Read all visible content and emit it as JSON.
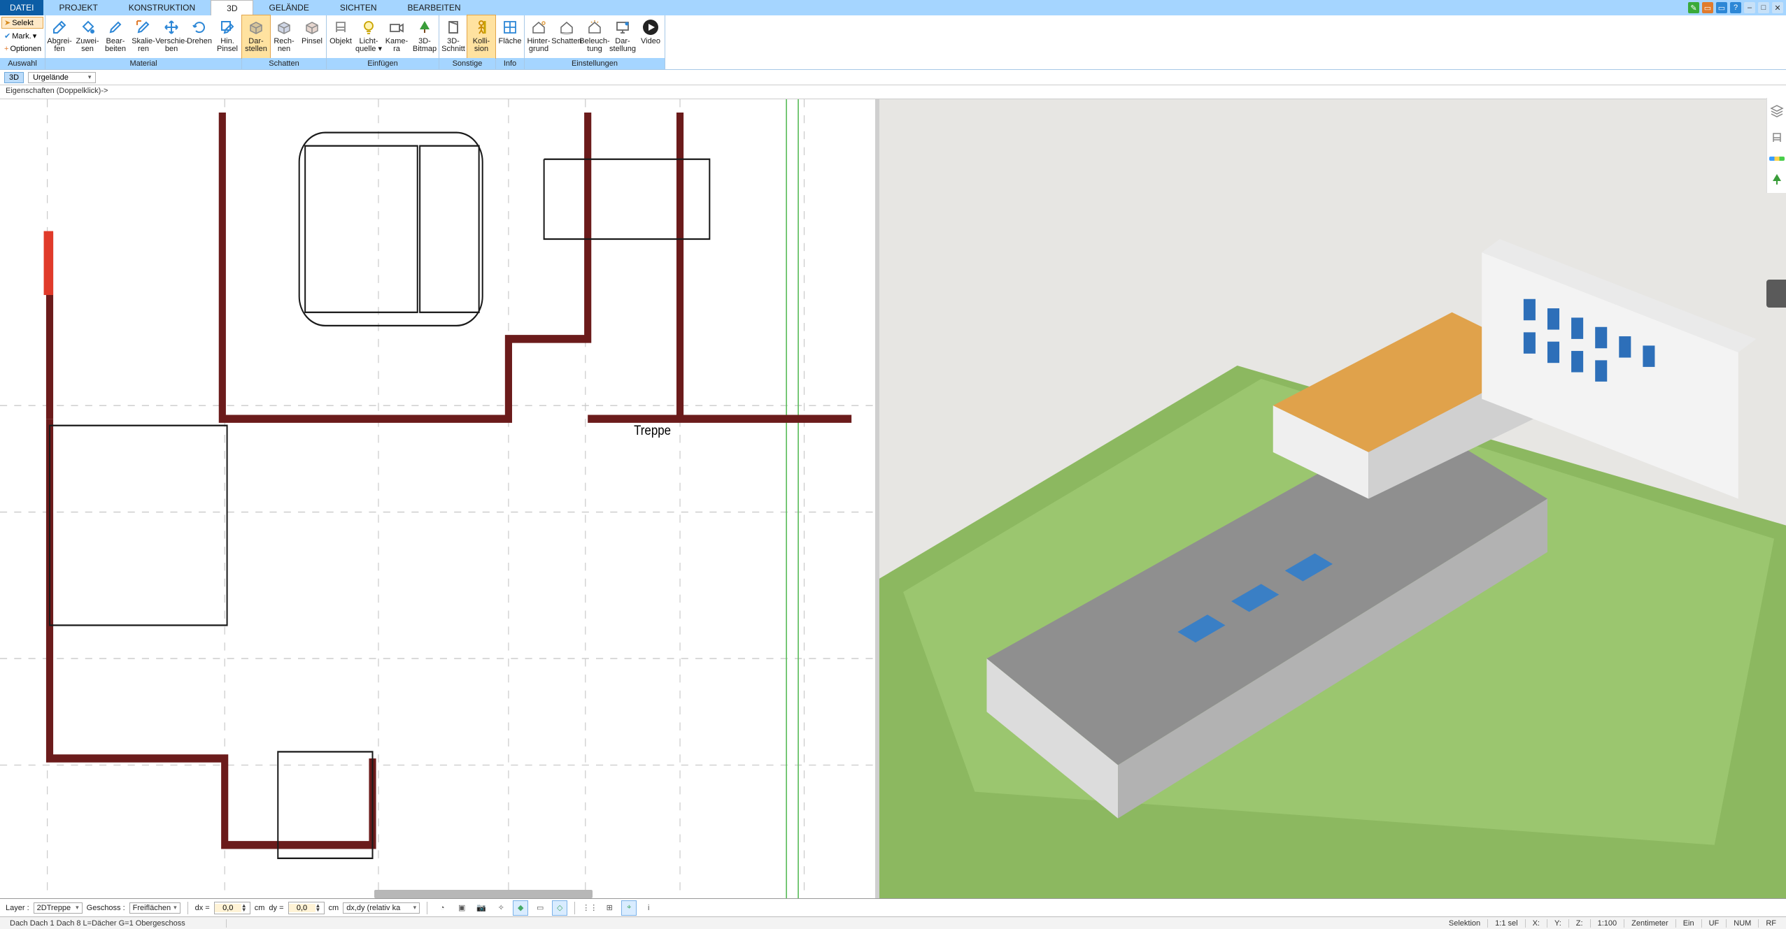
{
  "menu": {
    "file": "DATEI",
    "tabs": [
      "PROJEKT",
      "KONSTRUKTION",
      "3D",
      "GELÄNDE",
      "SICHTEN",
      "BEARBEITEN"
    ],
    "active_idx": 2
  },
  "title_icons": [
    "✎",
    "🗗",
    "🗗",
    "?",
    "_",
    "□",
    "✕"
  ],
  "ribbon": {
    "sel_panel": {
      "select": "Selekt",
      "mark": "Mark.",
      "options": "Optionen",
      "group_label": "Auswahl"
    },
    "material": {
      "group_label": "Material",
      "tools": [
        {
          "id": "abgreifen",
          "label": "Abgrei-\nfen",
          "glyph": "pipette"
        },
        {
          "id": "zuweisen",
          "label": "Zuwei-\nsen",
          "glyph": "bucket"
        },
        {
          "id": "bearbeiten",
          "label": "Bear-\nbeiten",
          "glyph": "brush-edit"
        },
        {
          "id": "skalieren",
          "label": "Skalie-\nren",
          "glyph": "brush-scale"
        },
        {
          "id": "verschieben",
          "label": "Verschie-\nben",
          "glyph": "move"
        },
        {
          "id": "drehen",
          "label": "Drehen",
          "glyph": "rotate"
        },
        {
          "id": "hinpinsel",
          "label": "Hin.\nPinsel",
          "glyph": "brush-back"
        }
      ]
    },
    "schatten": {
      "group_label": "Schatten",
      "tools": [
        {
          "id": "darstellen",
          "label": "Dar-\nstellen",
          "glyph": "box-sun",
          "active": true
        },
        {
          "id": "rechnen",
          "label": "Rech-\nnen",
          "glyph": "box-calc"
        },
        {
          "id": "pinsel",
          "label": "Pinsel",
          "glyph": "box-brush"
        }
      ]
    },
    "einfuegen": {
      "group_label": "Einfügen",
      "tools": [
        {
          "id": "objekt",
          "label": "Objekt",
          "glyph": "chair"
        },
        {
          "id": "lichtquelle",
          "label": "Licht-\nquelle ▾",
          "glyph": "bulb"
        },
        {
          "id": "kamera",
          "label": "Kame-\nra",
          "glyph": "camera"
        },
        {
          "id": "3dbitmap",
          "label": "3D-\nBitmap",
          "glyph": "tree"
        }
      ]
    },
    "sonstige": {
      "group_label": "Sonstige",
      "tools": [
        {
          "id": "3dschnitt",
          "label": "3D-\nSchnitt",
          "glyph": "door"
        },
        {
          "id": "kollision",
          "label": "Kolli-\nsion",
          "glyph": "person",
          "active": true
        }
      ]
    },
    "info": {
      "group_label": "Info",
      "tools": [
        {
          "id": "flaeche",
          "label": "Fläche",
          "glyph": "ruler-area"
        }
      ]
    },
    "einstellungen": {
      "group_label": "Einstellungen",
      "tools": [
        {
          "id": "hintergrund",
          "label": "Hinter-\ngrund",
          "glyph": "house-bg"
        },
        {
          "id": "schatten-set",
          "label": "Schatten",
          "glyph": "house-shadow"
        },
        {
          "id": "beleuchtung",
          "label": "Beleuch-\ntung",
          "glyph": "house-light"
        },
        {
          "id": "darstellung",
          "label": "Dar-\nstellung",
          "glyph": "monitor"
        },
        {
          "id": "video",
          "label": "Video",
          "glyph": "play"
        }
      ]
    }
  },
  "secbar": {
    "btn3d": "3D",
    "combo": "Urgelände"
  },
  "propbar": "Eigenschaften (Doppelklick)->",
  "plan_labels": {
    "treppe": "Treppe"
  },
  "bottom": {
    "layer_label": "Layer :",
    "layer_combo": "2DTreppe",
    "floor_label": "Geschoss :",
    "floor_combo": "Freiflächen",
    "dx_label": "dx =",
    "dx_val": "0,0",
    "dx_unit": "cm",
    "dy_label": "dy =",
    "dy_val": "0,0",
    "dy_unit": "cm",
    "mode_combo": "dx,dy (relativ ka"
  },
  "status": {
    "left": "Dach Dach 1 Dach 8 L=Dächer G=1 Obergeschoss",
    "selektion": "Selektion",
    "scale": "1:1 sel",
    "x": "X:",
    "y": "Y:",
    "z": "Z:",
    "zoom": "1:100",
    "unit": "Zentimeter",
    "ein": "Ein",
    "uf": "UF",
    "num": "NUM",
    "rf": "RF"
  }
}
